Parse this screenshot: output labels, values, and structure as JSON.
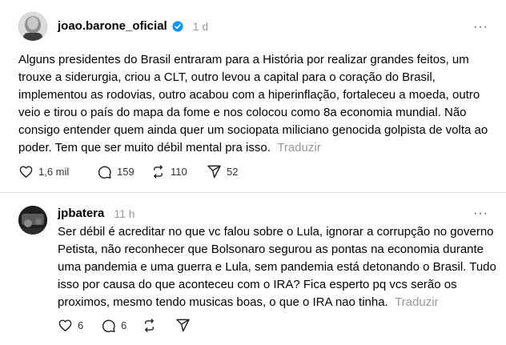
{
  "posts": [
    {
      "username": "joao.barone_oficial",
      "time": "1 d",
      "verified": true,
      "text": "Alguns presidentes do Brasil entraram para a História por realizar grandes feitos, um trouxe a siderurgia, criou a CLT, outro levou a capital para o coração do Brasil, implementou as rodovias, outro acabou com a hiperinflação, fortaleceu a moeda, outro veio e tirou o país do mapa da fome e nos colocou como 8a economia mundial. Não consigo entender quem ainda quer um sociopata miliciano genocida golpista de volta ao poder. Tem que ser muito débil mental pra isso.",
      "translate": "Traduzir",
      "likes": "1,6 mil",
      "replies": "159",
      "reposts": "110",
      "shares": "52"
    },
    {
      "username": "jpbatera",
      "time": "11 h",
      "verified": false,
      "text": "Ser débil é acreditar no que vc falou sobre o Lula, ignorar a corrupção no governo Petista, não reconhecer que Bolsonaro segurou as pontas na economia durante uma pandemia e uma guerra e Lula, sem pandemia está detonando o Brasil. Tudo isso por causa do que aconteceu com o IRA? Fica esperto pq vcs serão os proximos, mesmo tendo musicas boas, o que o IRA nao tinha.",
      "translate": "Traduzir",
      "likes": "6",
      "replies": "6"
    }
  ],
  "more_label": "···",
  "colors": {
    "verified": "#0095f6",
    "muted": "#999999"
  }
}
